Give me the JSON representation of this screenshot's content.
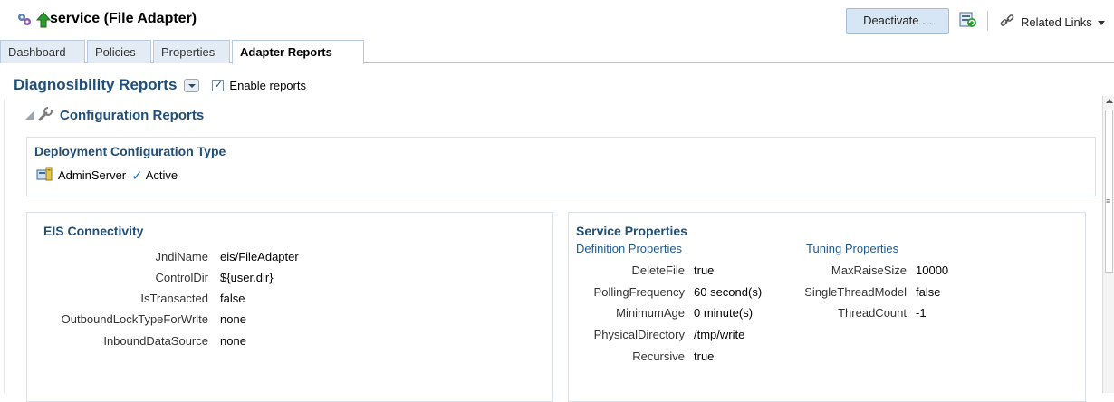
{
  "header": {
    "title": "service (File Adapter)",
    "deactivate_label": "Deactivate ...",
    "related_links_label": "Related Links",
    "icons": [
      "adapter-icon",
      "up-arrow-icon",
      "refresh-icon",
      "link-icon",
      "dropdown-arrow-icon"
    ]
  },
  "tabs": [
    {
      "label": "Dashboard",
      "active": false
    },
    {
      "label": "Policies",
      "active": false
    },
    {
      "label": "Properties",
      "active": false
    },
    {
      "label": "Adapter Reports",
      "active": true
    }
  ],
  "reports": {
    "title": "Diagnosibility Reports",
    "enable_label": "Enable reports",
    "enabled": true,
    "config_title": "Configuration Reports"
  },
  "deployment": {
    "title": "Deployment Configuration Type",
    "server": "AdminServer",
    "status": "Active"
  },
  "eis": {
    "title": "EIS Connectivity",
    "rows": [
      {
        "key": "JndiName",
        "value": "eis/FileAdapter"
      },
      {
        "key": "ControlDir",
        "value": "${user.dir}"
      },
      {
        "key": "IsTransacted",
        "value": "false"
      },
      {
        "key": "OutboundLockTypeForWrite",
        "value": "none"
      },
      {
        "key": "InboundDataSource",
        "value": "none"
      }
    ]
  },
  "service": {
    "title": "Service Properties",
    "definition_title": "Definition Properties",
    "definition_rows": [
      {
        "key": "DeleteFile",
        "value": "true"
      },
      {
        "key": "PollingFrequency",
        "value": "60 second(s)"
      },
      {
        "key": "MinimumAge",
        "value": "0 minute(s)"
      },
      {
        "key": "PhysicalDirectory",
        "value": "/tmp/write"
      },
      {
        "key": "Recursive",
        "value": "true"
      }
    ],
    "tuning_title": "Tuning Properties",
    "tuning_rows": [
      {
        "key": "MaxRaiseSize",
        "value": "10000"
      },
      {
        "key": "SingleThreadModel",
        "value": "false"
      },
      {
        "key": "ThreadCount",
        "value": "-1"
      }
    ]
  },
  "colors": {
    "accent": "#1f4f7a",
    "button_bg": "#d6e6f5",
    "tab_bg": "#e3ecf4"
  }
}
